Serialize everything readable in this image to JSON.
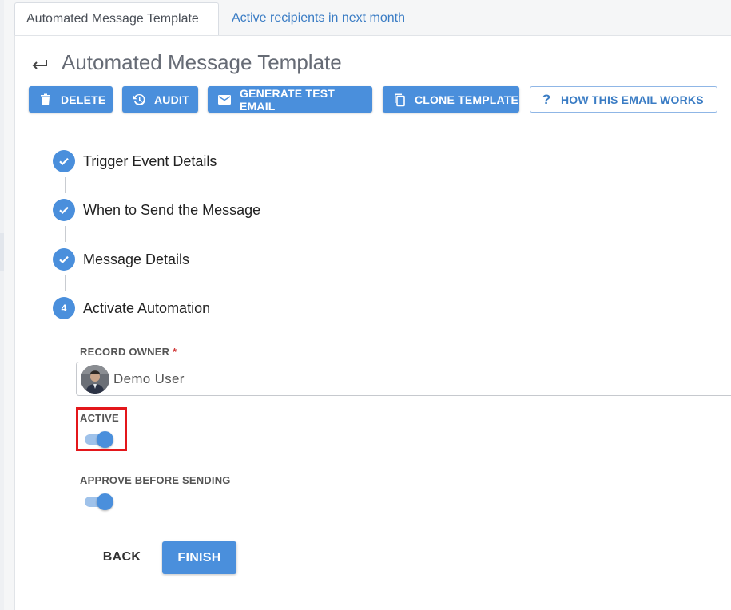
{
  "tabs": [
    {
      "label": "Automated Message Template"
    },
    {
      "label": "Active recipients in next month"
    }
  ],
  "header": {
    "title": "Automated Message Template"
  },
  "toolbar": {
    "delete_label": "DELETE",
    "audit_label": "AUDIT",
    "generate_test_email_label": "GENERATE TEST EMAIL",
    "clone_template_label": "CLONE TEMPLATE",
    "how_this_email_works_label": "HOW THIS EMAIL WORKS",
    "help_glyph": "?"
  },
  "steps": [
    {
      "label": "Trigger Event Details",
      "state": "complete",
      "icon": "check-icon"
    },
    {
      "label": "When to Send the Message",
      "state": "complete",
      "icon": "check-icon"
    },
    {
      "label": "Message Details",
      "state": "complete",
      "icon": "check-icon"
    },
    {
      "label": "Activate Automation",
      "state": "current",
      "number": "4"
    }
  ],
  "form": {
    "record_owner": {
      "label": "RECORD OWNER",
      "required_mark": "*",
      "value": "Demo User"
    },
    "active": {
      "label": "ACTIVE",
      "on": true
    },
    "approve_before_sending": {
      "label": "APPROVE BEFORE SENDING",
      "on": true
    }
  },
  "footer": {
    "back_label": "BACK",
    "finish_label": "FINISH"
  },
  "colors": {
    "accent": "#4a8fdc",
    "highlight": "#e3171b",
    "link": "#3a7cc4"
  }
}
